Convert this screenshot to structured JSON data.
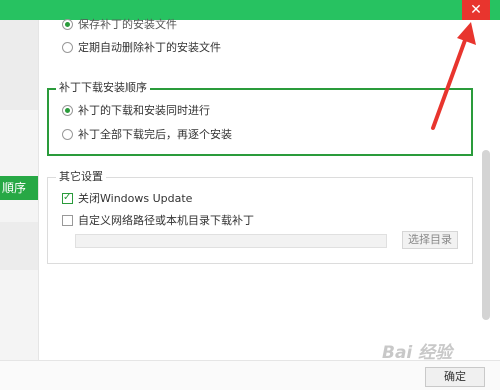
{
  "titlebar": {
    "close_label": "✕"
  },
  "sidebar": {
    "selected_label": "順序"
  },
  "group_top": {
    "options": [
      "保存补丁的安装文件",
      "定期自动删除补丁的安装文件"
    ]
  },
  "group_order": {
    "legend": "补丁下载安装顺序",
    "options": [
      "补丁的下载和安装同时进行",
      "补丁全部下载完后，再逐个安装"
    ]
  },
  "group_other": {
    "legend": "其它设置",
    "windows_update_label": "关闭Windows Update",
    "custom_path_label": "自定义网络路径或本机目录下载补丁",
    "choose_dir_label": "选择目录"
  },
  "footer": {
    "confirm_label": "确定"
  },
  "watermark": "Bai 经验",
  "colors": {
    "accent": "#27c261",
    "close": "#e8352e",
    "arrow": "#e8352e",
    "selected": "#2a9b3b"
  }
}
